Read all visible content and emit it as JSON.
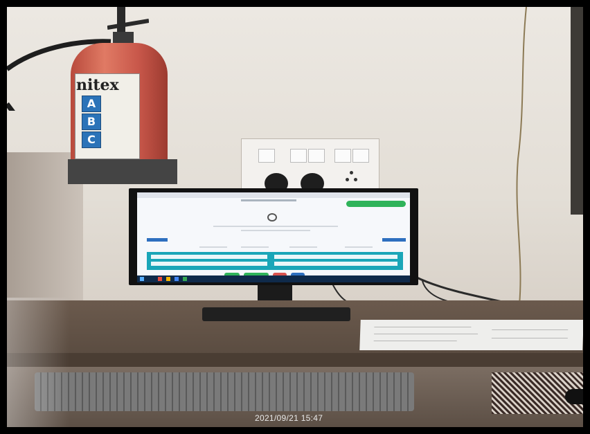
{
  "photo": {
    "timestamp": "2021/09/21 15:47",
    "extinguisher": {
      "brand": "nitex",
      "classes": [
        "A",
        "B",
        "C"
      ],
      "body_color": "#c8574a",
      "label_badge_color": "#2b73b8"
    },
    "monitor": {
      "accent_color": "#1aa6b8",
      "action_button_color": "#2fb35a",
      "taskbar_color": "#0f2a4a"
    },
    "wall_color": "#e6e1da",
    "desk_color": "#5c4f45"
  }
}
